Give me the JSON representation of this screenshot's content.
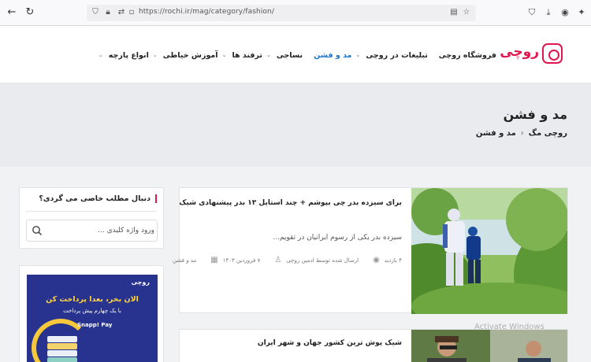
{
  "browser": {
    "url": "https://rochi.ir/mag/category/fashion/"
  },
  "site": {
    "logo_text": "روچی",
    "brand_color": "#e0174f",
    "active_color": "#1e73c7",
    "menu": [
      {
        "label": "انواع پارچه",
        "has_dropdown": true
      },
      {
        "label": "آموزش خیاطی",
        "has_dropdown": true
      },
      {
        "label": "ترفند ها",
        "has_dropdown": true
      },
      {
        "label": "نساجی",
        "has_dropdown": true
      },
      {
        "label": "مد و فشن",
        "has_dropdown": false,
        "active": true
      },
      {
        "label": "تبلیغات در روچی",
        "has_dropdown": true
      },
      {
        "label": "فروشگاه روچی",
        "has_dropdown": false
      }
    ]
  },
  "page": {
    "title": "مد و فشن",
    "breadcrumb": [
      "روچی مگ",
      "مد و فشن"
    ]
  },
  "posts": [
    {
      "title": "برای سیزده بدر چی بپوشم + چند استایل ۱۳ بدر پیشنهادی شیک",
      "excerpt": "سیزده بدر یکی از رسوم ایرانیان در تقویم...",
      "category": "مد و فشن",
      "date": "۷ فروردین ۱۴۰۳",
      "author": "ارسال شده توسط ادمین روچی",
      "views": "۴ بازدید"
    },
    {
      "title": "شیک پوش ترین کشور جهان و شهر ایران"
    }
  ],
  "sidebar": {
    "search_title": "دنبال مطلب خاصی می گردی؟",
    "search_placeholder": "ورود واژه کلیدی ..."
  },
  "ad": {
    "logo": "روچی",
    "headline": "الان بخر، بعدا پرداخت کن",
    "subline": "با یک چهارم پیش پرداخت",
    "partner": "Snapp! Pay"
  },
  "os_watermark": "Activate Windows"
}
